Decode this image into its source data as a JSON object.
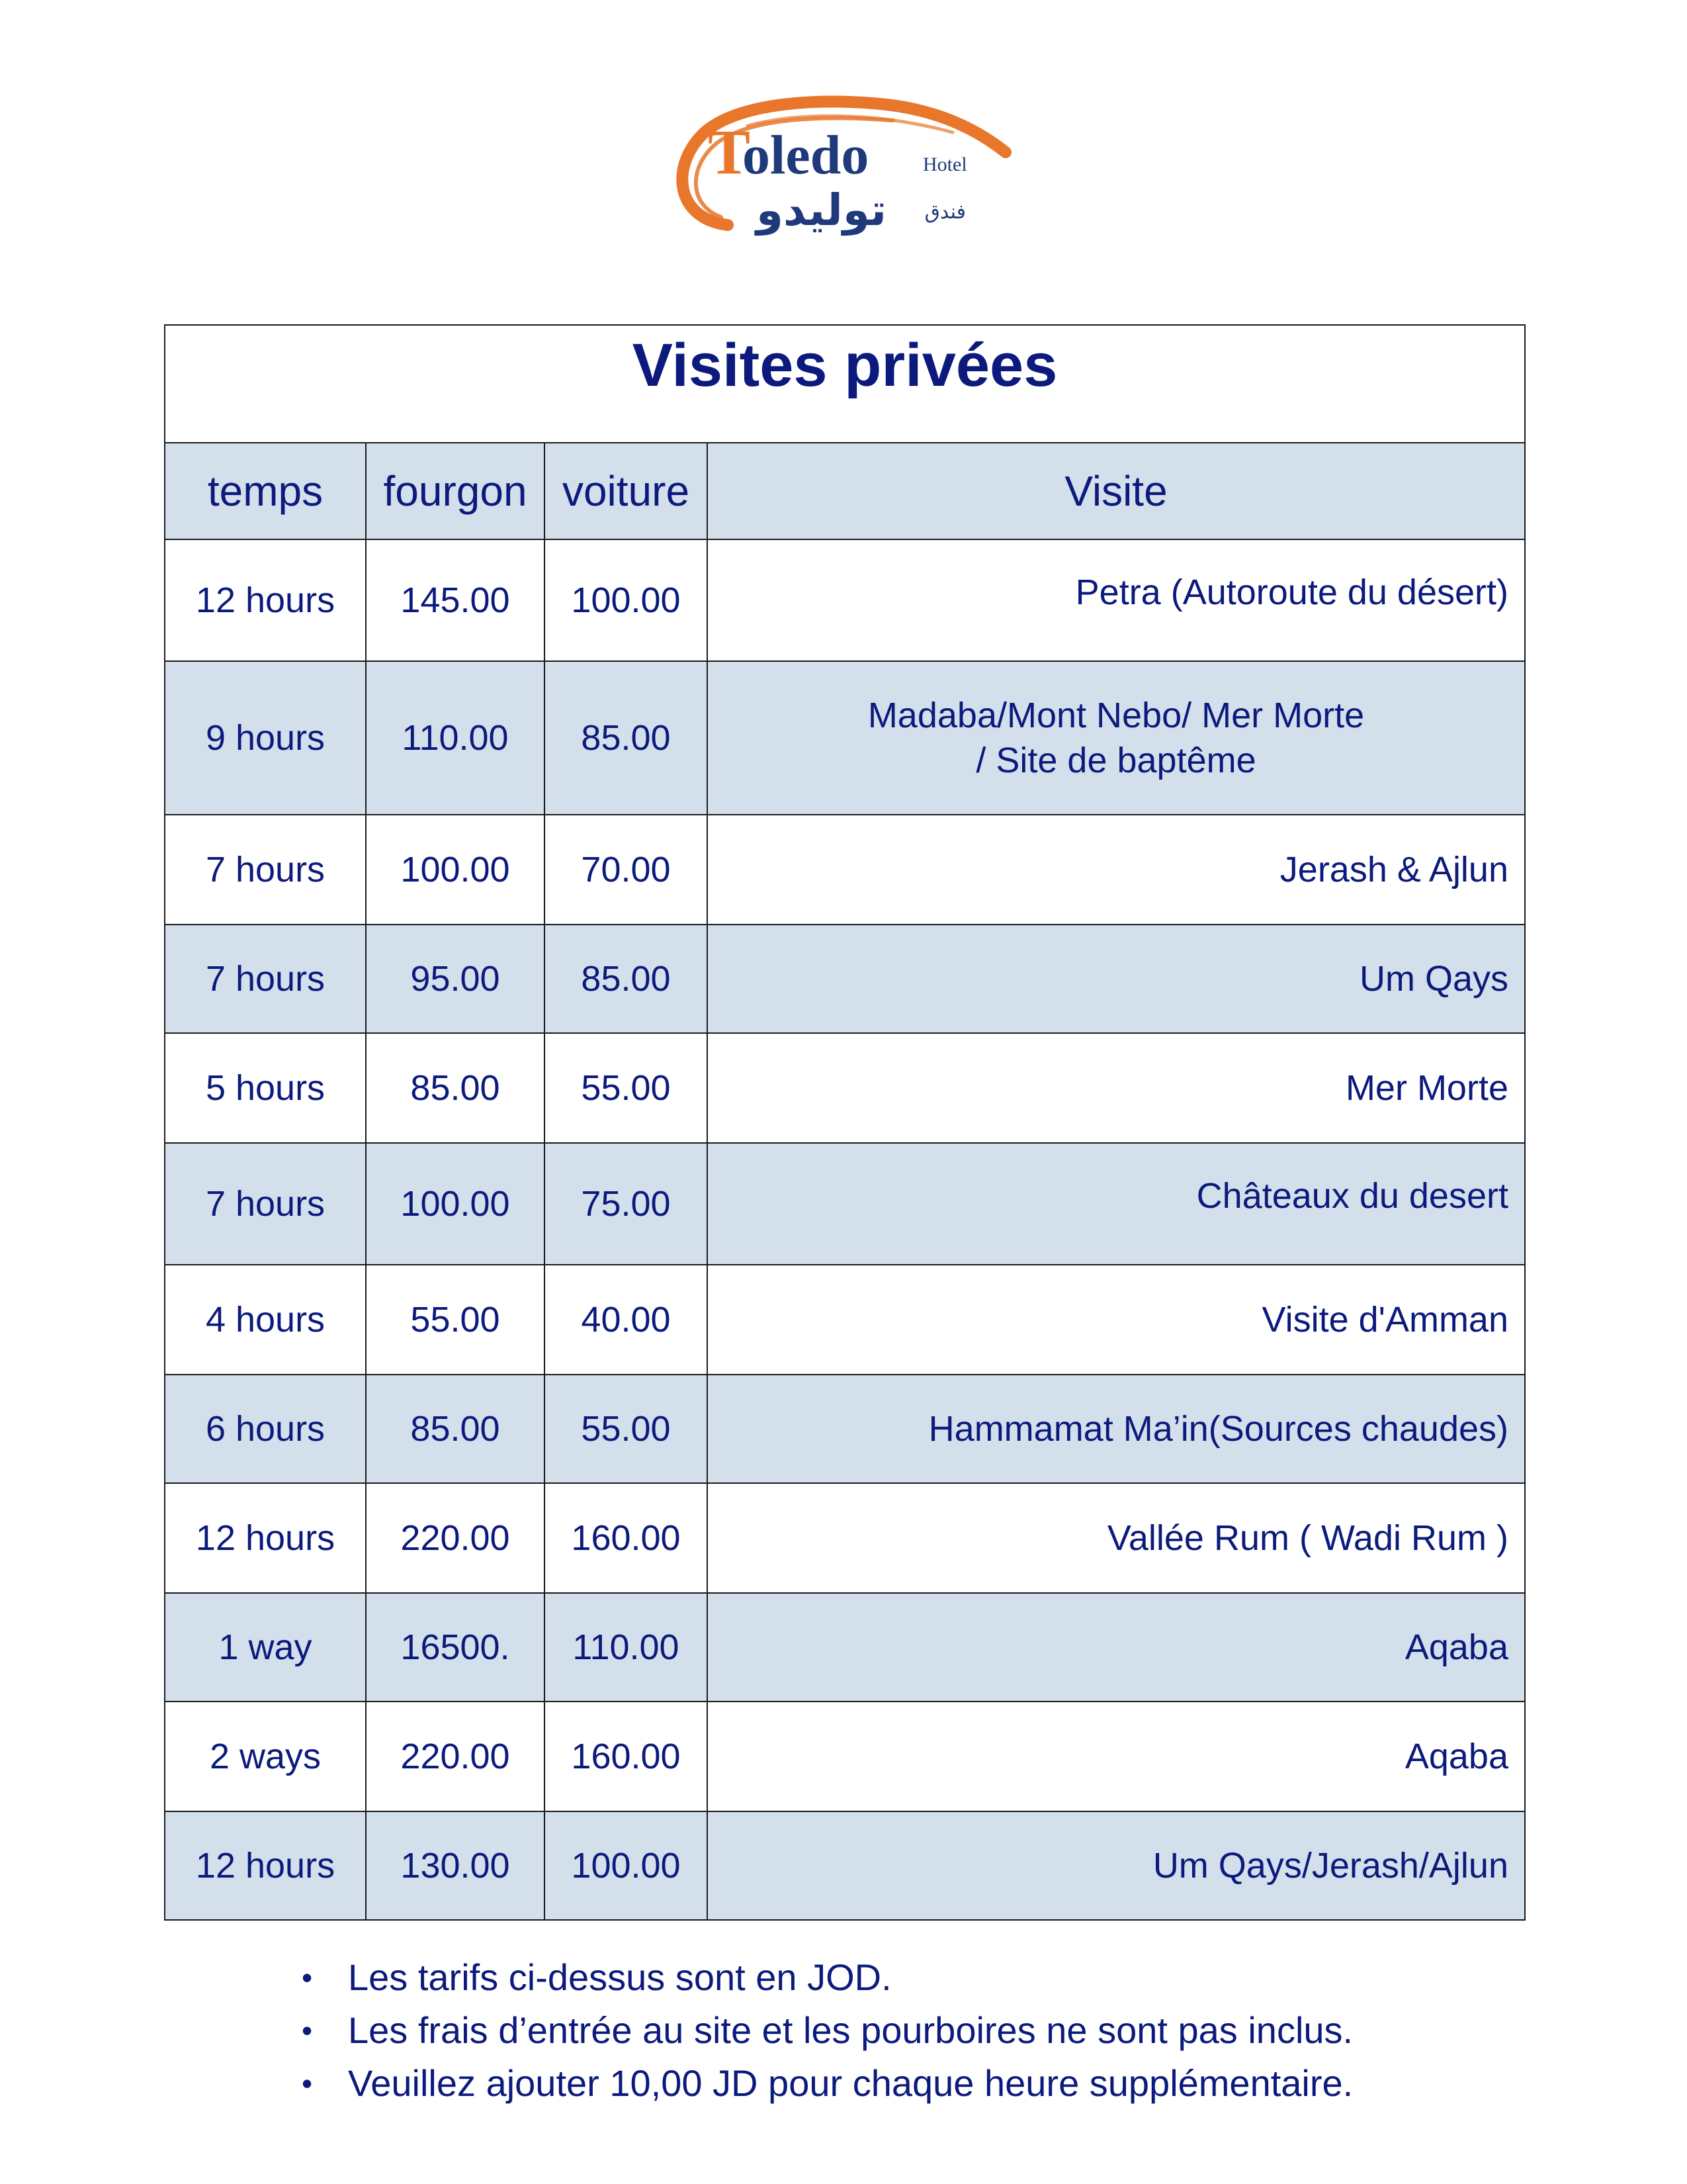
{
  "logo": {
    "wordmark_initial": "T",
    "wordmark_rest": "oledo",
    "wordmark_suffix": "Hotel",
    "arabic_name": "توليدو",
    "arabic_prefix": "فندق",
    "colors": {
      "swoosh": "#e8772c",
      "text": "#1f3a7a"
    }
  },
  "table": {
    "title": "Visites privées",
    "headers": [
      "temps",
      "fourgon",
      "voiture",
      "Visite"
    ],
    "rows": [
      {
        "temps": "12 hours",
        "fourgon": "145.00",
        "voiture": "100.00",
        "visite": "Petra (Autoroute du désert)"
      },
      {
        "temps": "9 hours",
        "fourgon": "110.00",
        "voiture": "85.00",
        "visite_line1": "Madaba/Mont Nebo/ Mer Morte",
        "visite_line2": "/ Site de baptême"
      },
      {
        "temps": "7 hours",
        "fourgon": "100.00",
        "voiture": "70.00",
        "visite": "Jerash & Ajlun"
      },
      {
        "temps": "7 hours",
        "fourgon": "95.00",
        "voiture": "85.00",
        "visite": "Um Qays"
      },
      {
        "temps": "5 hours",
        "fourgon": "85.00",
        "voiture": "55.00",
        "visite": "Mer Morte"
      },
      {
        "temps": "7 hours",
        "fourgon": "100.00",
        "voiture": "75.00",
        "visite": "Châteaux du desert"
      },
      {
        "temps": "4 hours",
        "fourgon": "55.00",
        "voiture": "40.00",
        "visite": "Visite d'Amman"
      },
      {
        "temps": "6 hours",
        "fourgon": "85.00",
        "voiture": "55.00",
        "visite": "Hammamat Ma’in(Sources chaudes)"
      },
      {
        "temps": "12 hours",
        "fourgon": "220.00",
        "voiture": "160.00",
        "visite": "Vallée Rum ( Wadi Rum )"
      },
      {
        "temps": "1 way",
        "fourgon": "16500.",
        "voiture": "110.00",
        "visite": "Aqaba"
      },
      {
        "temps": "2 ways",
        "fourgon": "220.00",
        "voiture": "160.00",
        "visite": "Aqaba"
      },
      {
        "temps": "12 hours",
        "fourgon": "130.00",
        "voiture": "100.00",
        "visite": "Um Qays/Jerash/Ajlun"
      }
    ]
  },
  "notes": {
    "bullet": "•",
    "items": [
      "Les tarifs ci-dessus sont en JOD.",
      "Les frais d’entrée au site et les pourboires ne sont pas inclus.",
      "Veuillez ajouter 10,00 JD pour chaque heure supplémentaire."
    ]
  },
  "colors": {
    "text": "#0b1a7c",
    "row_shade": "#d3dfeb",
    "border": "#1a1a1a"
  }
}
